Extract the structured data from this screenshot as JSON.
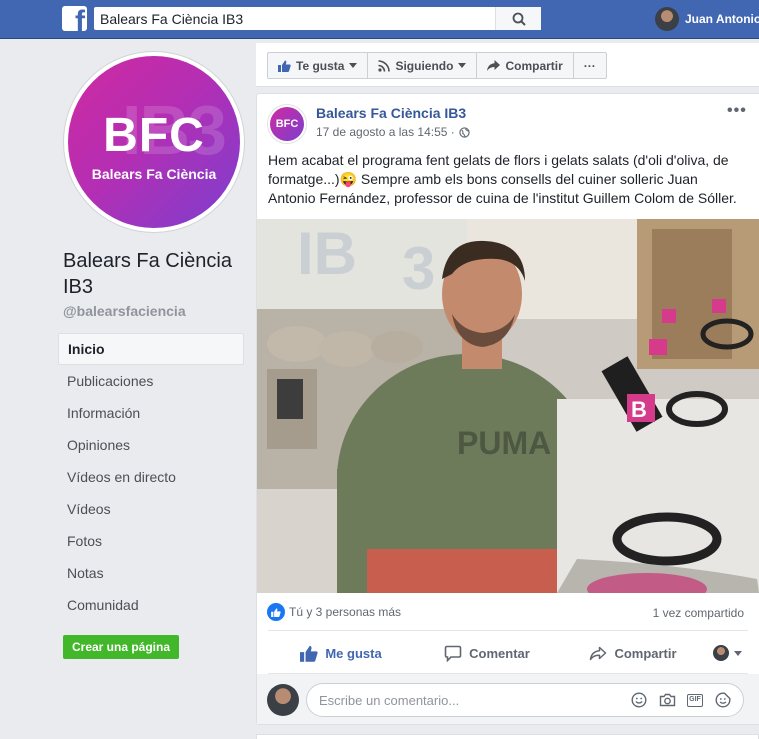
{
  "topbar": {
    "logo": "f",
    "search_value": "Balears Fa Ciència IB3",
    "user_name": "Juan Antonio"
  },
  "profile": {
    "logo_big": "BFC",
    "logo_sub": "Balears Fa Ciència",
    "page_name": "Balears Fa Ciència IB3",
    "handle": "@balearsfaciencia"
  },
  "nav": [
    {
      "label": "Inicio",
      "active": true
    },
    {
      "label": "Publicaciones"
    },
    {
      "label": "Información"
    },
    {
      "label": "Opiniones"
    },
    {
      "label": "Vídeos en directo"
    },
    {
      "label": "Vídeos"
    },
    {
      "label": "Fotos"
    },
    {
      "label": "Notas"
    },
    {
      "label": "Comunidad"
    }
  ],
  "create_page_label": "Crear una página",
  "actionbar": {
    "like_label": "Te gusta",
    "follow_label": "Siguiendo",
    "share_label": "Compartir",
    "more_label": "···"
  },
  "post": {
    "author": "Balears Fa Ciència IB3",
    "date": "17 de agosto a las 14:55 ·",
    "more": "•••",
    "text": "Hem acabat el programa fent gelats de flors i gelats salats (d'oli d'oliva, de formatge...)😜 Sempre amb els bons consells del cuiner solleric Juan Antonio Fernández, professor de cuina de l'institut Guillem Colom de Sóller.",
    "reactions_text": "Tú y 3 personas más",
    "shares_text": "1 vez compartido",
    "actions": {
      "like": "Me gusta",
      "comment": "Comentar",
      "share": "Compartir"
    },
    "comment_placeholder": "Escribe un comentario..."
  },
  "colors": {
    "brand_blue": "#4267b2",
    "link_blue": "#365899",
    "create_green": "#42b72a",
    "bfc_magenta": "#cf2aa0",
    "bfc_violet": "#7b3fcf"
  }
}
